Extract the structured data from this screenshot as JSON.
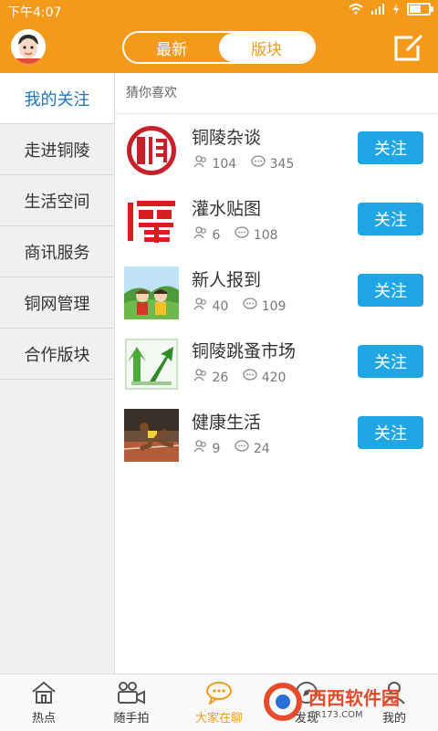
{
  "status": {
    "time": "下午4:07"
  },
  "header": {
    "tabs": [
      {
        "label": "最新"
      },
      {
        "label": "版块"
      }
    ],
    "active_tab_index": 1
  },
  "sidebar": {
    "items": [
      {
        "label": "我的关注"
      },
      {
        "label": "走进铜陵"
      },
      {
        "label": "生活空间"
      },
      {
        "label": "商讯服务"
      },
      {
        "label": "铜网管理"
      },
      {
        "label": "合作版块"
      }
    ],
    "active_index": 0
  },
  "content": {
    "subheading": "猜你喜欢",
    "forums": [
      {
        "name": "铜陵杂谈",
        "members": "104",
        "posts": "345",
        "button": "关注",
        "icon": "tongling-seal-icon"
      },
      {
        "name": "灌水贴图",
        "members": "6",
        "posts": "108",
        "button": "关注",
        "icon": "guan-character-icon"
      },
      {
        "name": "新人报到",
        "members": "40",
        "posts": "109",
        "button": "关注",
        "icon": "cartoon-people-icon"
      },
      {
        "name": "铜陵跳蚤市场",
        "members": "26",
        "posts": "420",
        "button": "关注",
        "icon": "green-arrow-icon"
      },
      {
        "name": "健康生活",
        "members": "9",
        "posts": "24",
        "button": "关注",
        "icon": "sprinter-photo-icon"
      }
    ]
  },
  "bottom_nav": {
    "items": [
      {
        "label": "热点",
        "icon": "home-icon"
      },
      {
        "label": "随手拍",
        "icon": "camera-icon"
      },
      {
        "label": "大家在聊",
        "icon": "chat-icon"
      },
      {
        "label": "发现",
        "icon": "discover-icon"
      },
      {
        "label": "我的",
        "icon": "profile-icon"
      }
    ],
    "active_index": 2
  },
  "watermark": {
    "main": "西西软件园",
    "sub": "CR173.COM"
  },
  "colors": {
    "brand_orange": "#f39a1b",
    "follow_blue": "#20a6e5",
    "active_blue": "#1e73be"
  }
}
